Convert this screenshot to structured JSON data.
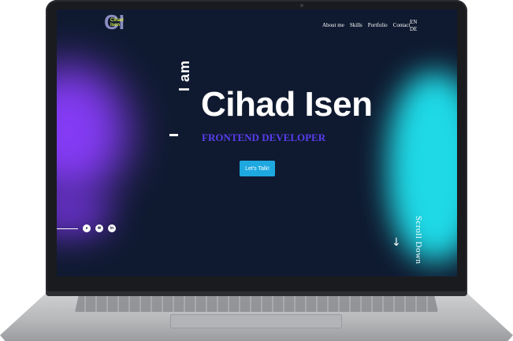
{
  "logo": {
    "monogram": "CI",
    "line1": "Cihad",
    "line2": "Isen"
  },
  "nav": {
    "items": [
      "About me",
      "Skills",
      "Portfolio",
      "Contact"
    ],
    "languages": [
      "EN",
      "DE"
    ]
  },
  "hero": {
    "intro": "I am",
    "name": "Cihad Isen",
    "role": "FRONTEND DEVELOPER",
    "cta_label": "Let's Talk!"
  },
  "social": {
    "icons": [
      "github-icon",
      "email-icon",
      "linkedin-icon"
    ],
    "glyphs": [
      "●",
      "✉",
      "in"
    ]
  },
  "scroll": {
    "label": "Scroll Down",
    "arrow": "↓"
  },
  "colors": {
    "background": "#0f1a30",
    "accent_purple": "#8b3dff",
    "accent_cyan": "#1fd9e6",
    "role_text": "#5a3df0",
    "button": "#1ea8e0",
    "logo_text": "#d7e84c"
  }
}
